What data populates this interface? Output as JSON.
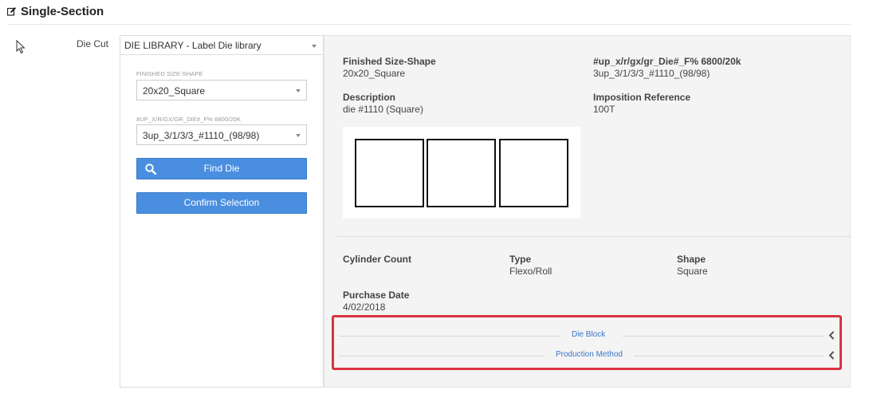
{
  "section": {
    "title": "Single-Section",
    "icon": "edit-icon"
  },
  "die_cut": {
    "label": "Die Cut",
    "library_select_value": "DIE LIBRARY - Label Die library",
    "finished_size": {
      "label": "FINISHED SIZE-SHAPE",
      "value": "20x20_Square"
    },
    "up_field": {
      "label": "#UP_X/R/GX/GR_DIE#_F% 6800/20K",
      "value": "3up_3/1/3/3_#1110_(98/98)"
    },
    "find_button": "Find Die",
    "find_icon": "search-icon",
    "confirm_button": "Confirm Selection"
  },
  "details": {
    "finished_size_label": "Finished Size-Shape",
    "finished_size_value": "20x20_Square",
    "up_label": "#up_x/r/gx/gr_Die#_F% 6800/20k",
    "up_value": "3up_3/1/3/3_#1110_(98/98)",
    "description_label": "Description",
    "description_value": "die #1110 (Square)",
    "imposition_label": "Imposition Reference",
    "imposition_value": "100T",
    "cylinder_label": "Cylinder Count",
    "type_label": "Type",
    "type_value": "Flexo/Roll",
    "shape_label": "Shape",
    "shape_value": "Square",
    "purchase_label": "Purchase Date",
    "purchase_value": "4/02/2018"
  },
  "accordion": [
    {
      "label": "Die Block",
      "icon": "chevron-left-icon"
    },
    {
      "label": "Production Method",
      "icon": "chevron-left-icon"
    }
  ],
  "colors": {
    "accent_blue": "#4a8ee0",
    "highlight_red": "#d9333f",
    "link_blue": "#3a76c8"
  }
}
